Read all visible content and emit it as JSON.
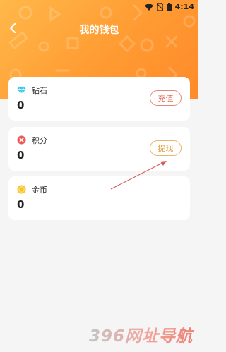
{
  "status_bar": {
    "time": "4:14"
  },
  "header": {
    "title": "我的钱包"
  },
  "cards": [
    {
      "label": "钻石",
      "value": "0",
      "button": "充值",
      "icon": "diamond-icon"
    },
    {
      "label": "积分",
      "value": "0",
      "button": "提现",
      "icon": "points-icon"
    },
    {
      "label": "金币",
      "value": "0",
      "icon": "coin-icon"
    }
  ],
  "watermark": {
    "text": "396网址导航"
  },
  "colors": {
    "header_orange": "#ff9b32",
    "recharge_border": "#e58778",
    "withdraw_border": "#e8b76c",
    "background": "#f5f5f5"
  }
}
